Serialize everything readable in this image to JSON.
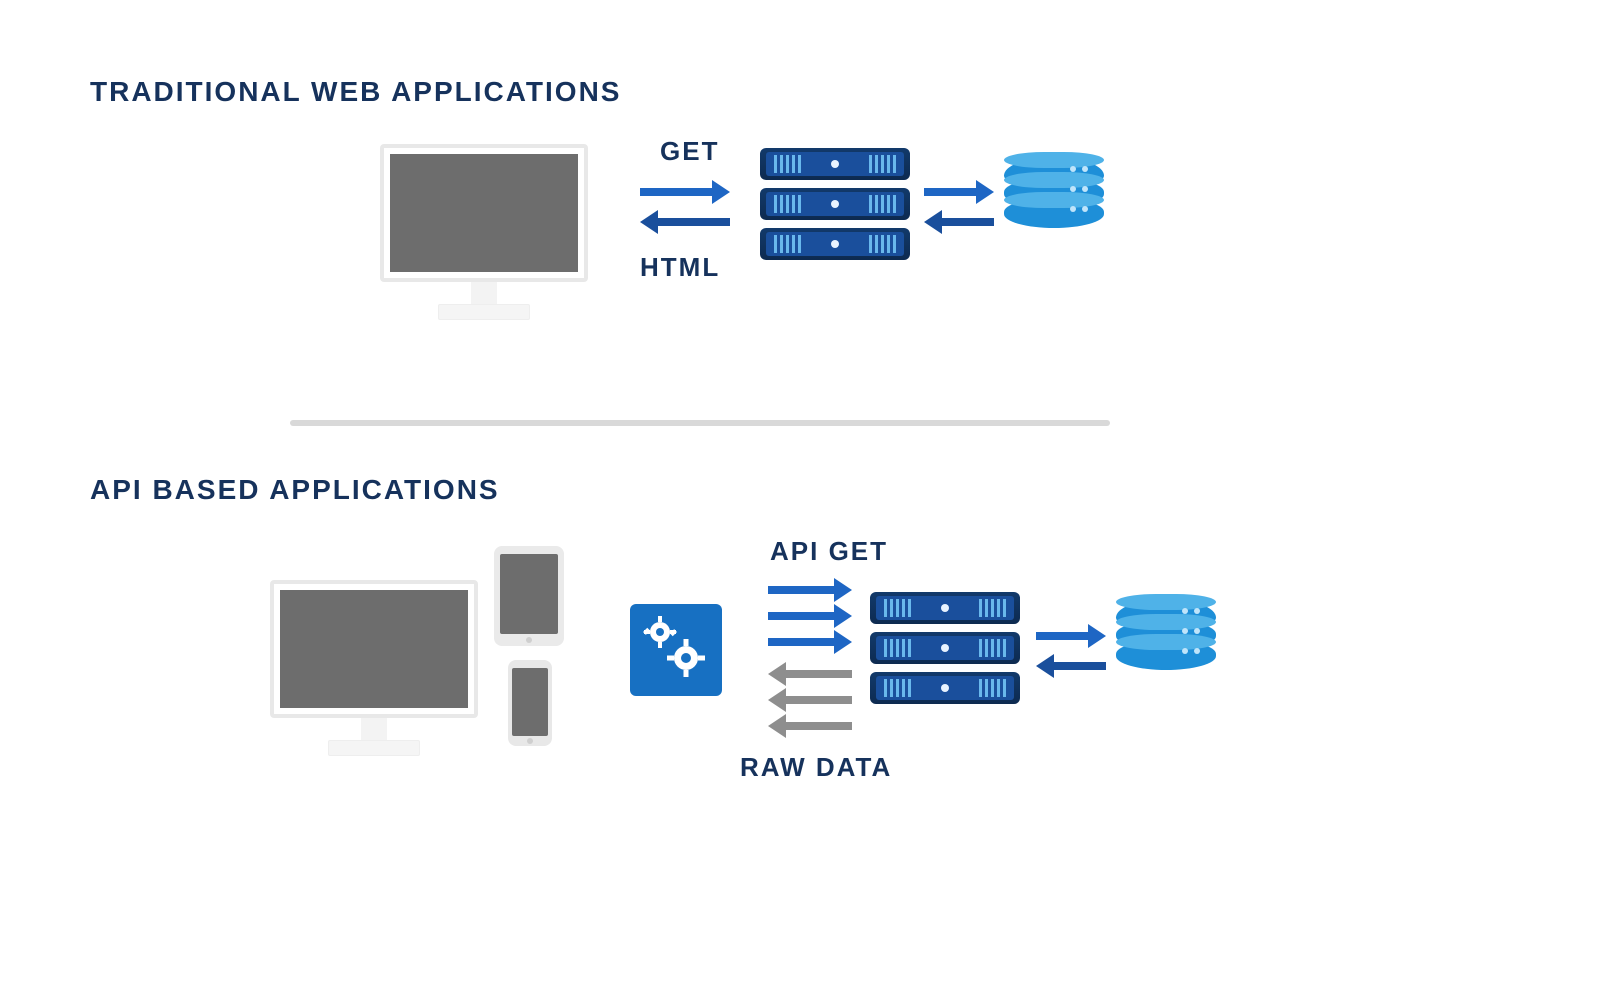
{
  "sections": {
    "traditional": {
      "title": "TRADITIONAL WEB APPLICATIONS",
      "request_label": "GET",
      "response_label": "HTML"
    },
    "api": {
      "title": "API BASED APPLICATIONS",
      "request_label": "API GET",
      "response_label": "RAW DATA"
    }
  },
  "nodes": {
    "client_monitor": "desktop-monitor",
    "client_tablet": "tablet",
    "client_phone": "phone",
    "api_gateway": "gears-service",
    "servers": "server-stack",
    "database": "database-cylinder"
  },
  "colors": {
    "heading": "#16325c",
    "arrow_blue": "#1e66c4",
    "arrow_darkblue": "#1a4f9c",
    "arrow_gray": "#8e8e8e",
    "db_blue": "#1e8fd8",
    "gears_bg": "#1770c2"
  }
}
